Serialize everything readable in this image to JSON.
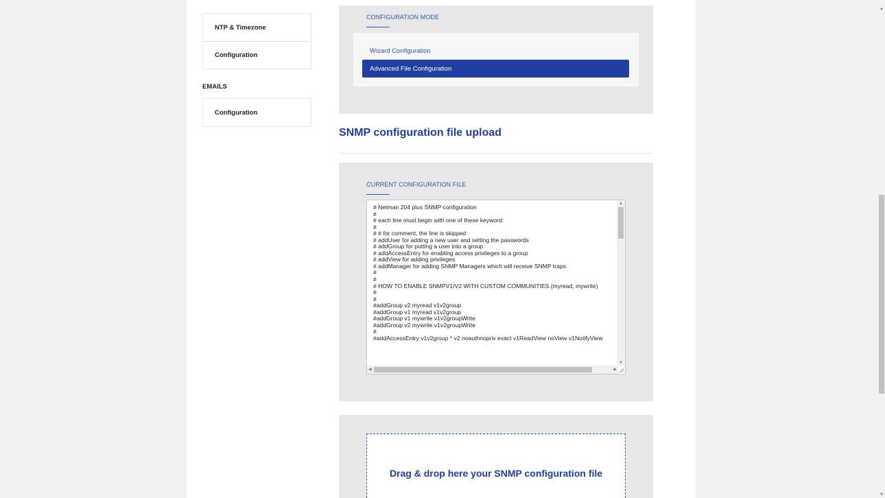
{
  "sidebar": {
    "items_top": [
      {
        "label": "NTP & Timezone"
      },
      {
        "label": "Configuration"
      }
    ],
    "emails_section": "EMAILS",
    "items_emails": [
      {
        "label": "Configuration"
      }
    ]
  },
  "config_mode": {
    "label": "CONFIGURATION MODE",
    "options": [
      {
        "label": "Wizard Configuration"
      },
      {
        "label": "Advanced File Configuration"
      }
    ]
  },
  "snmp": {
    "title": "SNMP configuration file upload",
    "current_label": "CURRENT CONFIGURATION FILE",
    "file_text": "# Netman 204 plus SNMP configuration\n#\n# each line must begin with one of these keyword:\n#\n# # for comment, the line is skipped\n# addUser for adding a new user and setting the passwords\n# addGroup for putting a user into a group\n# addAccessEntry for enabling access privileges to a group\n# addView for adding privileges\n# addManager for adding SNMP Managers which will receive SNMP traps\n#\n#\n# HOW TO ENABLE SNMPV1/V2 WITH CUSTOM COMMUNITIES (myread, mywrite)\n#\n#\n#addGroup v2 myread v1v2group\n#addGroup v1 myread v1v2group\n#addGroup v1 mywrite v1v2groupWrite\n#addGroup v2 mywrite v1v2groupWrite\n#\n#addAccessEntry v1v2group * v2 noauthnopriv exact v1ReadView noView v1NotifyView",
    "drop_text": "Drag & drop here your SNMP configuration file"
  }
}
